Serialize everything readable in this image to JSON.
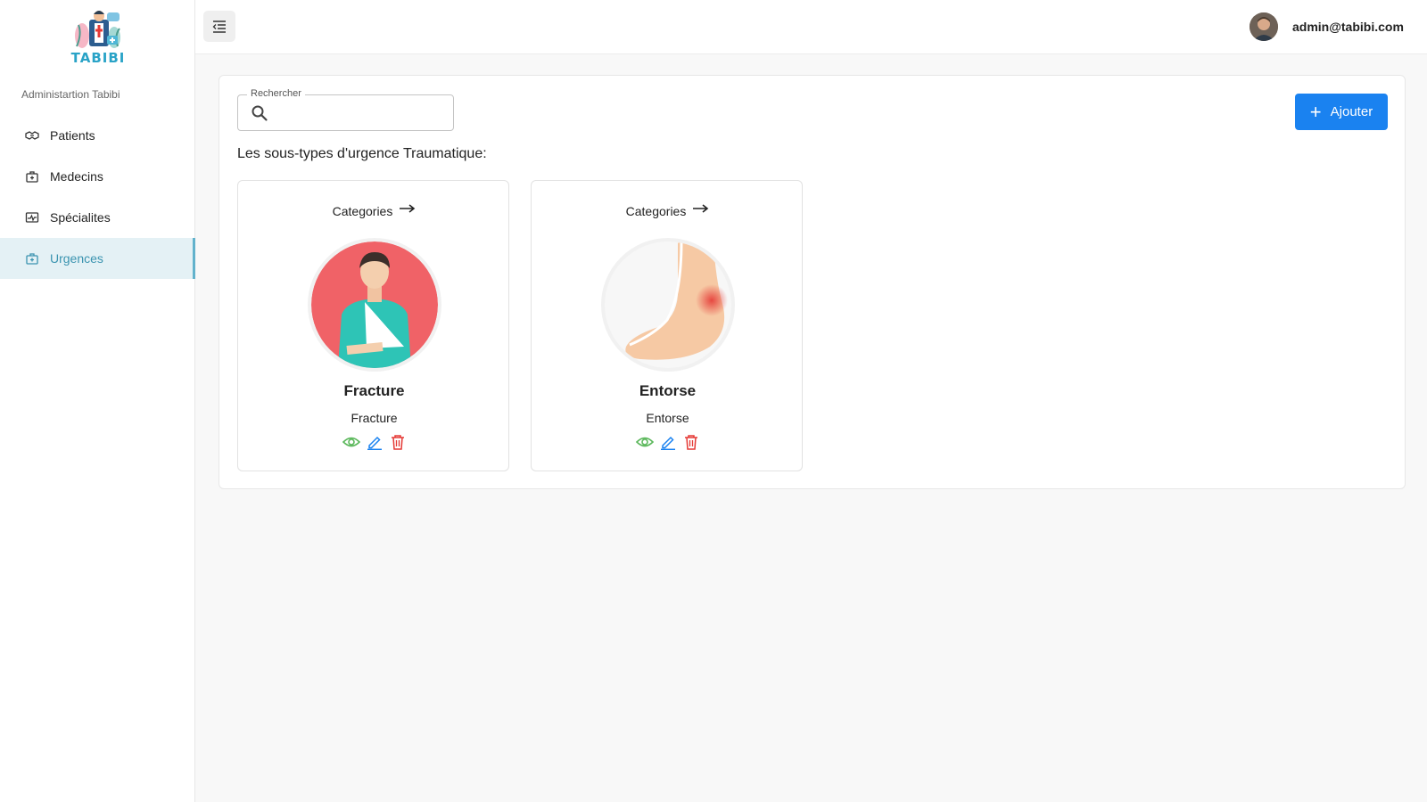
{
  "brand": {
    "name": "TABIBI",
    "caption": "Administartion Tabibi",
    "accent": "#2aa3c7"
  },
  "sidebar": {
    "items": [
      {
        "label": "Patients",
        "icon": "handshake-icon",
        "active": false
      },
      {
        "label": "Medecins",
        "icon": "medical-kit-icon",
        "active": false
      },
      {
        "label": "Spécialites",
        "icon": "pulse-chart-icon",
        "active": false
      },
      {
        "label": "Urgences",
        "icon": "first-aid-icon",
        "active": true
      }
    ]
  },
  "header": {
    "menu_icon": "menu-collapse-icon",
    "user_email": "admin@tabibi.com"
  },
  "search": {
    "legend": "Rechercher",
    "value": "",
    "placeholder": ""
  },
  "toolbar": {
    "add_label": "Ajouter",
    "add_color": "#1a82f0"
  },
  "section": {
    "title": "Les sous-types d'urgence Traumatique:"
  },
  "cards": [
    {
      "link_label": "Categories",
      "title": "Fracture",
      "subtitle": "Fracture",
      "image": "arm-sling-illustration"
    },
    {
      "link_label": "Categories",
      "title": "Entorse",
      "subtitle": "Entorse",
      "image": "ankle-sprain-illustration"
    }
  ],
  "colors": {
    "view": "#5cb85c",
    "edit": "#1a82f0",
    "delete": "#e53935",
    "active_nav_bg": "#e4f1f5",
    "active_nav_text": "#3b94b0"
  }
}
